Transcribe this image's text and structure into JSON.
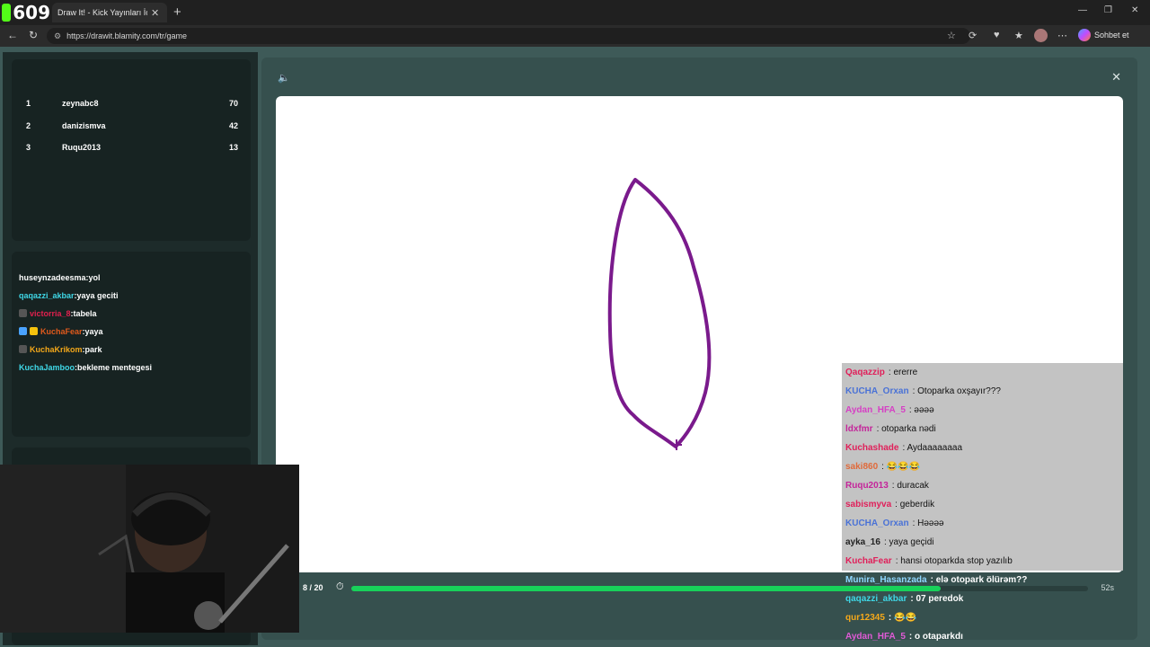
{
  "browser": {
    "viewer_count": "609",
    "tab_title": "Draw It! - Kick Yayınları İçin Ç",
    "url": "https://drawit.blamity.com/tr/game",
    "copilot_label": "Sohbet et"
  },
  "leaderboard": [
    {
      "rank": "1",
      "name": "zeynabc8",
      "score": "70"
    },
    {
      "rank": "2",
      "name": "danizismva",
      "score": "42"
    },
    {
      "rank": "3",
      "name": "Ruqu2013",
      "score": "13"
    }
  ],
  "guesses": [
    {
      "user": "huseynzadeesma",
      "text": ":yol",
      "color": "#ffffff",
      "badges": []
    },
    {
      "user": "qaqazzi_akbar",
      "text": ":yaya geciti",
      "color": "#3fd7e6",
      "badges": []
    },
    {
      "user": "victorria_8",
      "text": ":tabela",
      "color": "#e0204e",
      "badges": [
        "#555"
      ]
    },
    {
      "user": "KuchaFear",
      "text": ":yaya",
      "color": "#e05a1c",
      "badges": [
        "#4aa3ff",
        "#f4c20d"
      ]
    },
    {
      "user": "KuchaKrikom",
      "text": ":park",
      "color": "#f4a81a",
      "badges": [
        "#555"
      ]
    },
    {
      "user": "KuchaJamboo",
      "text": ":bekleme mentegesi",
      "color": "#3fd7e6",
      "badges": []
    }
  ],
  "game": {
    "round": "8 / 20",
    "time_left": "52s",
    "progress": 0.8,
    "stroke_color": "#7a1a8c"
  },
  "overlay_chat": [
    {
      "user": "Qaqazzip",
      "text": ": ererre",
      "color": "#e0205a",
      "style": "light"
    },
    {
      "user": "KUCHA_Orxan",
      "text": ": Otoparka oxşayır???",
      "color": "#4a72d6",
      "style": "light"
    },
    {
      "user": "Aydan_HFA_5",
      "text": ": əəəə",
      "color": "#d63fc4",
      "style": "light"
    },
    {
      "user": "ldxfmr",
      "text": ": otoparka nədi",
      "color": "#c4249a",
      "style": "light"
    },
    {
      "user": "Kuchashade",
      "text": ": Aydaaaaaaaa",
      "color": "#e0205a",
      "style": "light"
    },
    {
      "user": "saki860",
      "text": ": 😂😂😂",
      "color": "#e06a3a",
      "style": "light"
    },
    {
      "user": "Ruqu2013",
      "text": ": duracak",
      "color": "#c4249a",
      "style": "light"
    },
    {
      "user": "sabismyva",
      "text": ": geberdik",
      "color": "#e0205a",
      "style": "light"
    },
    {
      "user": "KUCHA_Orxan",
      "text": ": Həəəə",
      "color": "#4a72d6",
      "style": "light"
    },
    {
      "user": "ayka_16",
      "text": ": yaya geçidi",
      "color": "#222222",
      "style": "light"
    },
    {
      "user": "KuchaFear",
      "text": ": hansi otoparkda stop yazılıb",
      "color": "#e0205a",
      "style": "light"
    },
    {
      "user": "Munira_Hasanzada",
      "text": ": elə otopark ölürəm??",
      "color": "#8fd7ff",
      "style": "dark"
    },
    {
      "user": "qaqazzi_akbar",
      "text": ": 07 peredok",
      "color": "#3fd7e6",
      "style": "dark"
    },
    {
      "user": "qur12345",
      "text": ": 😂😂",
      "color": "#f4a81a",
      "style": "dark"
    },
    {
      "user": "Aydan_HFA_5",
      "text": ": o otaparkdı",
      "color": "#e05ad6",
      "style": "dark"
    }
  ]
}
